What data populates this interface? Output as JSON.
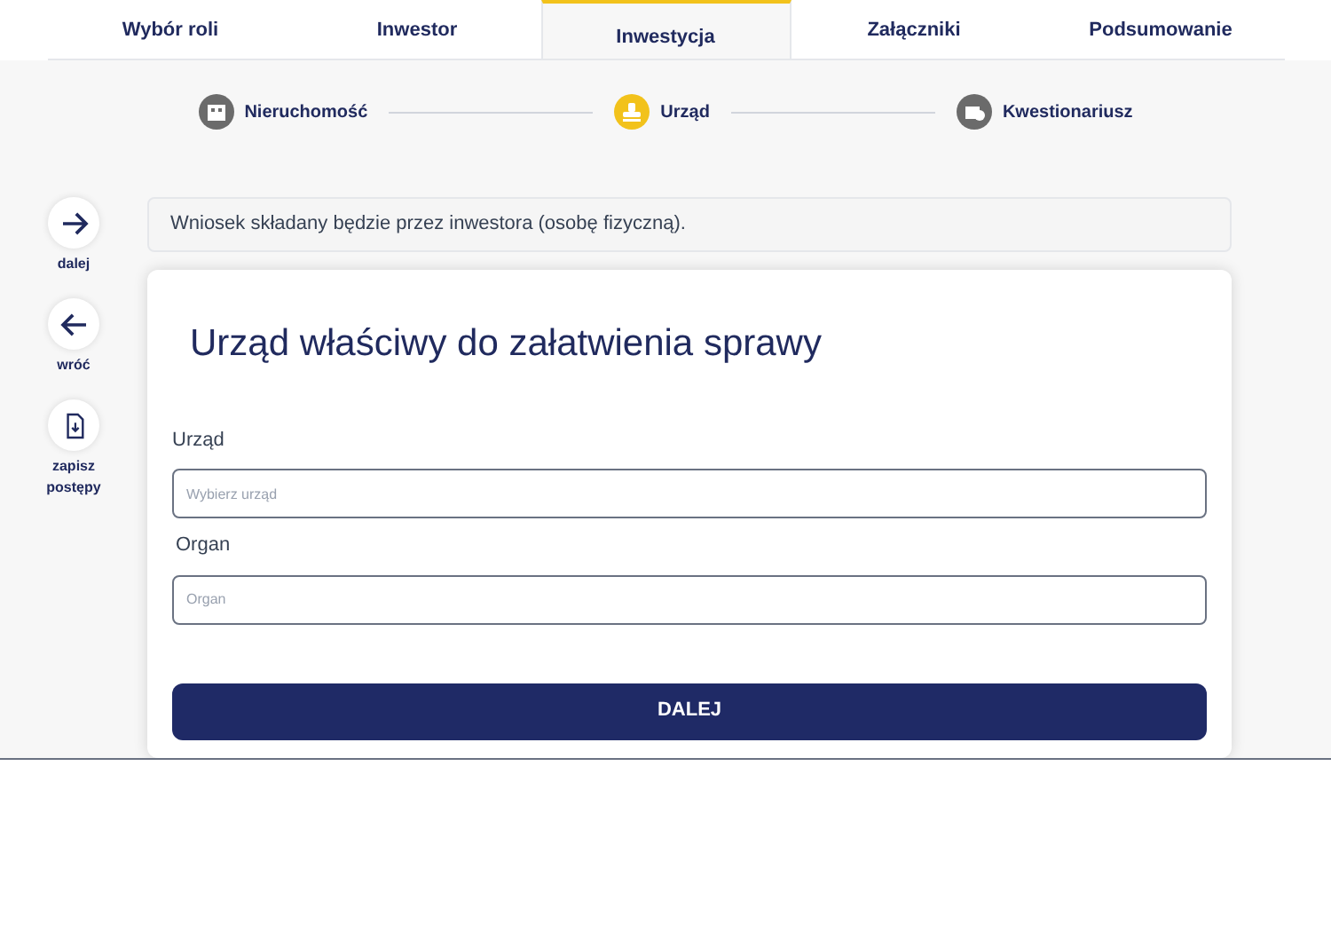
{
  "tabs": [
    {
      "label": "Wybór roli",
      "selected": false
    },
    {
      "label": "Inwestor",
      "selected": false
    },
    {
      "label": "Inwestycja",
      "selected": true
    },
    {
      "label": "Załączniki",
      "selected": false
    },
    {
      "label": "Podsumowanie",
      "selected": false
    }
  ],
  "steps": [
    {
      "label": "Nieruchomość",
      "kind": "building",
      "selected": false
    },
    {
      "label": "Urząd",
      "kind": "stamp",
      "selected": true
    },
    {
      "label": "Kwestionariusz",
      "kind": "form",
      "selected": false
    }
  ],
  "side_actions": [
    {
      "label": "dalej",
      "kind": "forward"
    },
    {
      "label": "wróć",
      "kind": "back"
    },
    {
      "label": "zapisz postępy",
      "kind": "save"
    }
  ],
  "notice": "Wniosek składany będzie przez inwestora (osobę fizyczną).",
  "form": {
    "title": "Urząd właściwy do załatwienia sprawy",
    "fields": [
      {
        "label": "Urząd",
        "placeholder": "Wybierz urząd"
      },
      {
        "label": "Organ",
        "placeholder": "Organ"
      }
    ],
    "submit": "DALEJ"
  }
}
